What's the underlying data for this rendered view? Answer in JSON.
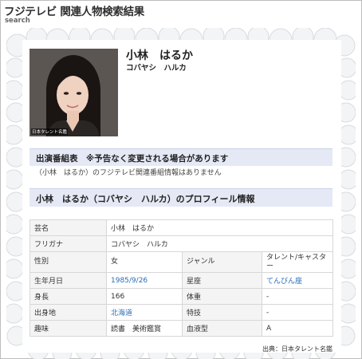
{
  "header": {
    "title": "フジテレビ 関連人物検索結果",
    "subtitle": "search"
  },
  "person": {
    "name": "小林　はるか",
    "kana": "コバヤシ　ハルカ",
    "photo_caption": "日本タレント名鑑"
  },
  "programs": {
    "heading": "出演番組表　※予告なく変更される場合があります",
    "note": "（小林　はるか）のフジテレビ関連番組情報はありません"
  },
  "profile": {
    "heading": "小林　はるか（コバヤシ　ハルカ）のプロフィール情報",
    "rows": [
      {
        "l1": "芸名",
        "v1": "小林　はるか"
      },
      {
        "l1": "フリガナ",
        "v1": "コバヤシ　ハルカ"
      },
      {
        "l1": "性別",
        "v1": "女",
        "l2": "ジャンル",
        "v2": "タレント/キャスター"
      },
      {
        "l1": "生年月日",
        "v1": "1985/9/26",
        "l2": "星座",
        "v2": "てんびん座"
      },
      {
        "l1": "身長",
        "v1": "166",
        "l2": "体重",
        "v2": "-"
      },
      {
        "l1": "出身地",
        "v1": "北海道",
        "l2": "特技",
        "v2": "-"
      },
      {
        "l1": "趣味",
        "v1": "読書　美術鑑賞",
        "l2": "血液型",
        "v2": "A"
      }
    ]
  },
  "source": "出典：日本タレント名鑑"
}
